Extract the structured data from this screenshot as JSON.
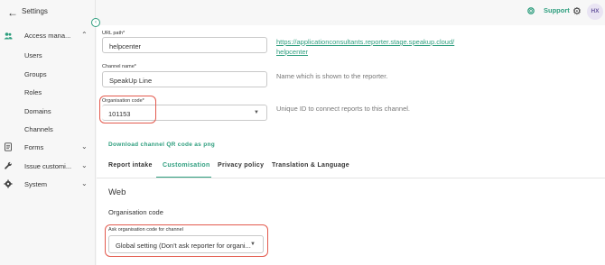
{
  "sidebar": {
    "title": "Settings",
    "items": [
      {
        "label": "Access mana...",
        "icon": "users-icon",
        "expanded": true
      },
      {
        "label": "Forms",
        "icon": "document-icon",
        "expanded": false
      },
      {
        "label": "Issue customi...",
        "icon": "wrench-icon",
        "expanded": false
      },
      {
        "label": "System",
        "icon": "gear-icon",
        "expanded": false
      }
    ],
    "subitems": [
      "Users",
      "Groups",
      "Roles",
      "Domains",
      "Channels"
    ]
  },
  "topbar": {
    "support_label": "Support",
    "avatar_initials": "HX"
  },
  "form": {
    "url_path": {
      "label": "URL path*",
      "value": "helpcenter",
      "link_line1": "https://applicationconsultants.reporter.stage.speakup.cloud/",
      "link_line2": "helpcenter"
    },
    "channel_name": {
      "label": "Channel name*",
      "value": "SpeakUp Line",
      "hint": "Name which is shown to the reporter."
    },
    "organisation_code": {
      "label": "Organisation code*",
      "value": "101153",
      "hint": "Unique ID to connect reports to this channel."
    },
    "qr_link": "Download channel QR code as png"
  },
  "tabs": [
    {
      "label": "Report intake",
      "active": false
    },
    {
      "label": "Customisation",
      "active": true
    },
    {
      "label": "Privacy policy",
      "active": false
    },
    {
      "label": "Translation & Language",
      "active": false
    }
  ],
  "customisation": {
    "section_title": "Web",
    "subsection_title": "Organisation code",
    "ask_code": {
      "label": "Ask organisation code for channel",
      "value": "Global setting (Don't ask reporter for organi..."
    }
  },
  "colors": {
    "accent": "#2e9e7e",
    "highlight": "#e35a4e"
  }
}
